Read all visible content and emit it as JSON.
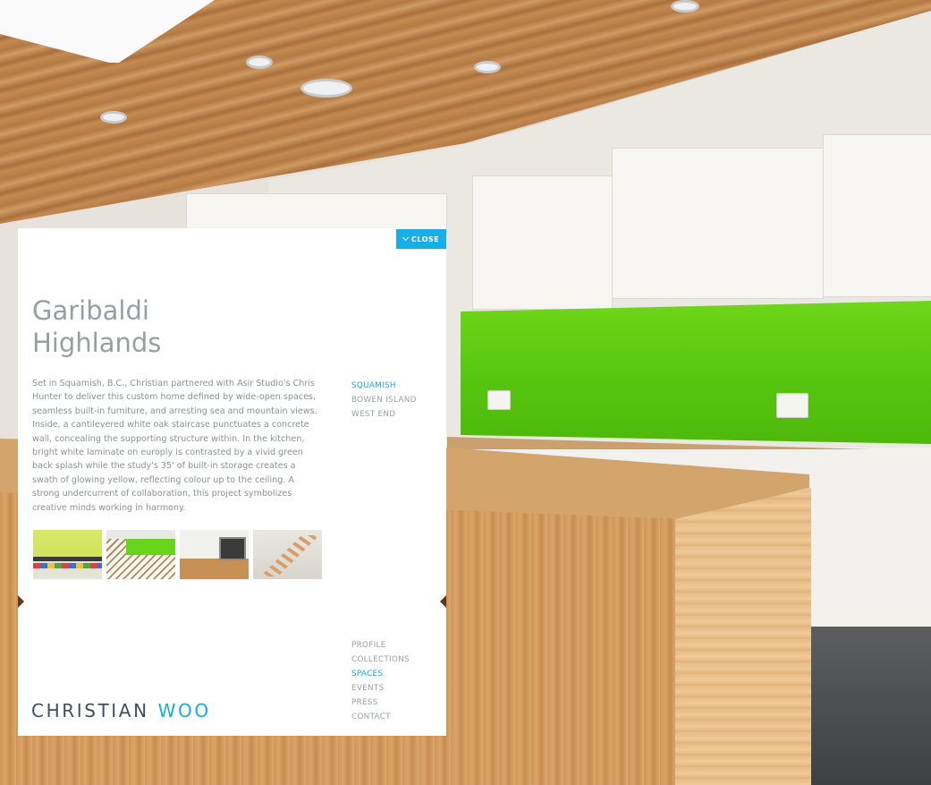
{
  "project": {
    "title_line1": "Garibaldi",
    "title_line2": "Highlands",
    "description": "Set in Squamish, B.C., Christian partnered with Asir Studio's Chris Hunter to deliver this custom home defined by wide-open spaces, seamless built-in furniture, and arresting sea and mountain views. Inside, a cantilevered white oak staircase punctuates a concrete wall, concealing the supporting structure within. In the kitchen, bright white laminate on europly is contrasted by a vivid green back splash while the study's 35' of built-in storage creates a swath of glowing yellow, reflecting colour up to the ceiling. A strong undercurrent of collaboration, this project symbolizes creative minds working in harmony."
  },
  "close_button": {
    "label": "CLOSE",
    "icon": "chevron-down-icon"
  },
  "sub_nav": [
    {
      "label": "SQUAMISH",
      "active": true
    },
    {
      "label": "BOWEN ISLAND",
      "active": false
    },
    {
      "label": "WEST END",
      "active": false
    }
  ],
  "main_nav": [
    {
      "label": "PROFILE",
      "active": false
    },
    {
      "label": "COLLECTIONS",
      "active": false
    },
    {
      "label": "SPACES",
      "active": true
    },
    {
      "label": "EVENTS",
      "active": false
    },
    {
      "label": "PRESS",
      "active": false
    },
    {
      "label": "CONTACT",
      "active": false
    }
  ],
  "thumbnails": [
    "yellow-study-thumbnail",
    "green-backsplash-thumbnail",
    "kitchen-oven-thumbnail",
    "oak-staircase-thumbnail"
  ],
  "logo": {
    "first": "CHRISTIAN",
    "last": "WOO"
  },
  "colors": {
    "accent": "#1aaee8",
    "logo_dark": "#3f4f5c",
    "text_gray": "#9aa0a4",
    "backsplash_green": "#5cc814"
  }
}
